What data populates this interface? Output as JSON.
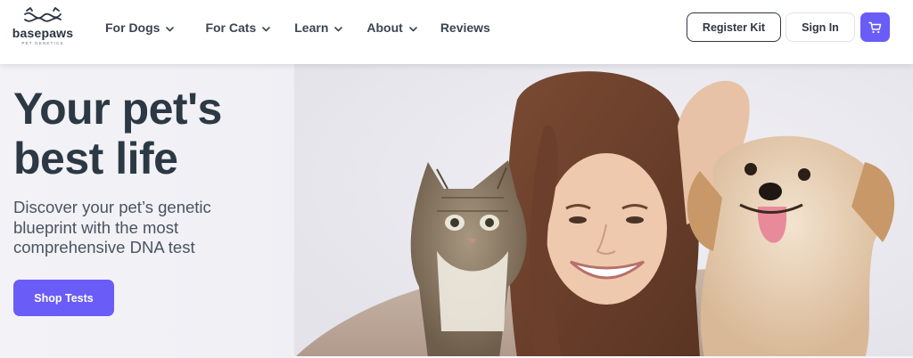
{
  "brand": {
    "name": "basepaws",
    "tagline": "PET GENETICS",
    "accent_color": "#6a5cf6",
    "text_color": "#2c3944"
  },
  "nav": {
    "items": [
      {
        "label": "For Dogs",
        "has_dropdown": true
      },
      {
        "label": "For Cats",
        "has_dropdown": true
      },
      {
        "label": "Learn",
        "has_dropdown": true
      },
      {
        "label": "About",
        "has_dropdown": true
      },
      {
        "label": "Reviews",
        "has_dropdown": false
      }
    ]
  },
  "header_actions": {
    "register_label": "Register Kit",
    "signin_label": "Sign In",
    "cart_icon": "cart-icon"
  },
  "hero": {
    "title": "Your pet's best life",
    "subtitle": "Discover your pet’s genetic blueprint with the most comprehensive DNA test",
    "cta_label": "Shop Tests",
    "image_subject": "woman-with-cat-and-dog"
  }
}
